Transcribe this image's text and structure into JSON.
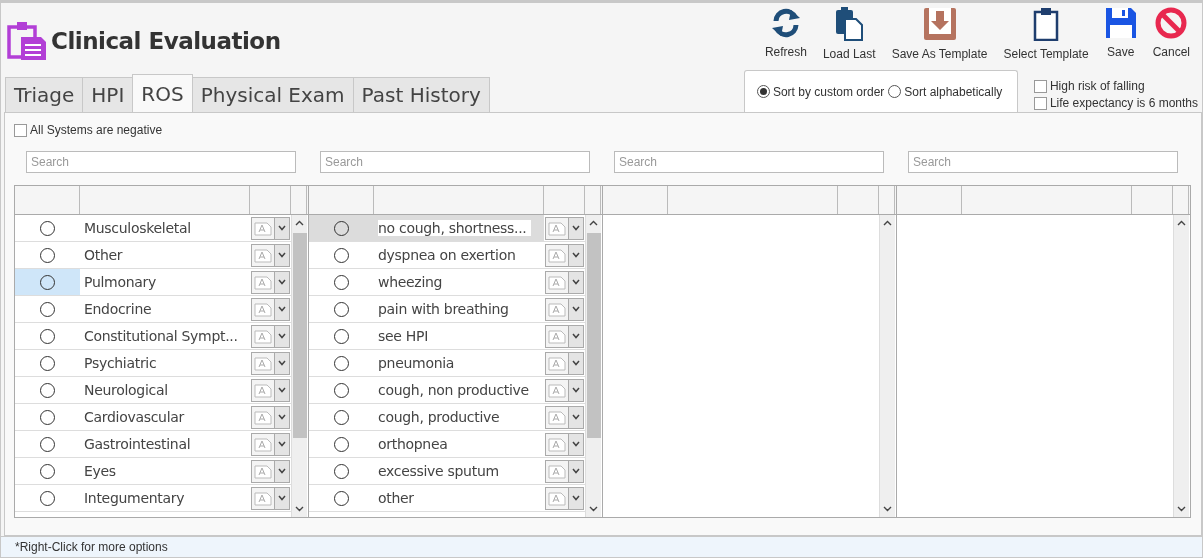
{
  "window": {
    "title": "Clinical Evaluation"
  },
  "toolbar": [
    {
      "label": "Refresh",
      "kind": "refresh"
    },
    {
      "label": "Load Last",
      "kind": "load"
    },
    {
      "label": "Save As Template",
      "kind": "saveTemplate"
    },
    {
      "label": "Select Template",
      "kind": "selectTemplate"
    },
    {
      "label": "Save",
      "kind": "save"
    },
    {
      "label": "Cancel",
      "kind": "cancel"
    }
  ],
  "tabs": [
    {
      "label": "Triage",
      "selected": false
    },
    {
      "label": "HPI",
      "selected": false
    },
    {
      "label": "ROS",
      "selected": true
    },
    {
      "label": "Physical Exam",
      "selected": false
    },
    {
      "label": "Past History",
      "selected": false
    }
  ],
  "sort_options": [
    {
      "label": "Sort by custom order",
      "selected": true
    },
    {
      "label": "Sort alphabetically",
      "selected": false
    }
  ],
  "flags": [
    {
      "label": "High risk of falling",
      "checked": false
    },
    {
      "label": "Life expectancy is 6 months",
      "checked": false
    }
  ],
  "all_negative": {
    "label": "All Systems are negative",
    "checked": false
  },
  "panels": [
    {
      "search_placeholder": "Search",
      "rows": [
        {
          "text": "Musculoskeletal",
          "checked": false,
          "selected": false
        },
        {
          "text": "Other",
          "checked": false,
          "selected": false
        },
        {
          "text": "Pulmonary",
          "checked": false,
          "selected": true
        },
        {
          "text": "Endocrine",
          "checked": false,
          "selected": false
        },
        {
          "text": "Constitutional Sympt...",
          "checked": false,
          "selected": false
        },
        {
          "text": "Psychiatric",
          "checked": false,
          "selected": false
        },
        {
          "text": "Neurological",
          "checked": false,
          "selected": false
        },
        {
          "text": "Cardiovascular",
          "checked": false,
          "selected": false
        },
        {
          "text": "Gastrointestinal",
          "checked": false,
          "selected": false
        },
        {
          "text": "Eyes",
          "checked": false,
          "selected": false
        },
        {
          "text": "Integumentary",
          "checked": false,
          "selected": false
        }
      ]
    },
    {
      "search_placeholder": "Search",
      "rows": [
        {
          "text": "no cough, shortness...",
          "checked": false,
          "selected": true
        },
        {
          "text": "dyspnea on exertion",
          "checked": false,
          "selected": false
        },
        {
          "text": "wheezing",
          "checked": false,
          "selected": false
        },
        {
          "text": "pain with breathing",
          "checked": false,
          "selected": false
        },
        {
          "text": "see HPI",
          "checked": false,
          "selected": false
        },
        {
          "text": "pneumonia",
          "checked": false,
          "selected": false
        },
        {
          "text": "cough, non productive",
          "checked": false,
          "selected": false
        },
        {
          "text": "cough, productive",
          "checked": false,
          "selected": false
        },
        {
          "text": "orthopnea",
          "checked": false,
          "selected": false
        },
        {
          "text": "excessive sputum",
          "checked": false,
          "selected": false
        },
        {
          "text": "other",
          "checked": false,
          "selected": false
        }
      ]
    },
    {
      "search_placeholder": "Search"
    },
    {
      "search_placeholder": "Search"
    }
  ],
  "status_bar": {
    "text": "*Right-Click for more options"
  }
}
